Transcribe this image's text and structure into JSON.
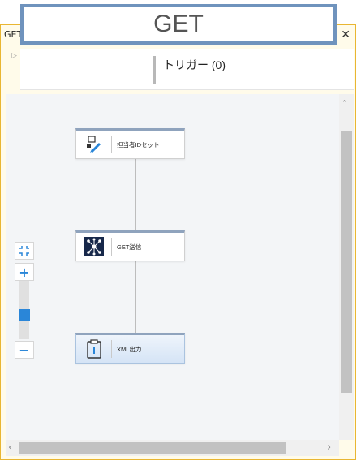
{
  "overlay": {
    "title": "GET"
  },
  "window": {
    "tab_title": "GET",
    "close_glyph": "✕"
  },
  "trigger": {
    "label": "トリガー (0)",
    "expand_glyph": "▷"
  },
  "nodes": [
    {
      "label": "担当者IDセット",
      "icon": "set-variable-icon"
    },
    {
      "label": "GET送信",
      "icon": "network-send-icon"
    },
    {
      "label": "XML出力",
      "icon": "clipboard-output-icon"
    }
  ],
  "zoom": {
    "fit_icon": "fit-to-screen-icon",
    "plus": "+",
    "minus": "−",
    "level": 0.4
  },
  "scrollbars": {
    "up": "˄",
    "left": "‹",
    "right": "›"
  },
  "colors": {
    "accent": "#2a86d8",
    "window_border": "#e9b632",
    "title_border": "#6f93bd"
  }
}
